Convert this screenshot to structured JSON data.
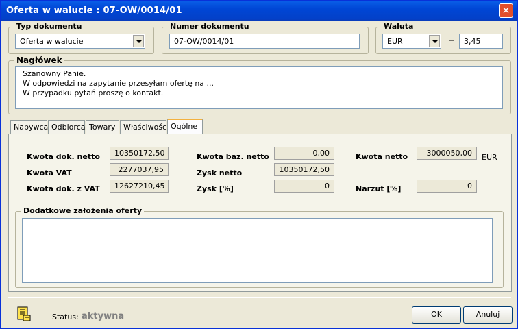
{
  "window": {
    "title": "Oferta w walucie : 07-OW/0014/01",
    "close_glyph": "✕"
  },
  "typ_dokumentu": {
    "legend": "Typ dokumentu",
    "value": "Oferta w walucie"
  },
  "numer_dokumentu": {
    "legend": "Numer dokumentu",
    "value": "07-OW/0014/01"
  },
  "waluta": {
    "legend": "Waluta",
    "value": "EUR",
    "equals": "=",
    "rate": "3,45"
  },
  "naglowek": {
    "legend": "Nagłówek",
    "lines": [
      "Szanowny Panie.",
      "W odpowiedzi na zapytanie przesyłam ofertę na ...",
      "W przypadku pytań proszę o kontakt."
    ]
  },
  "tabs": [
    {
      "label": "Nabywca"
    },
    {
      "label": "Odbiorca"
    },
    {
      "label": "Towary"
    },
    {
      "label": "Właściwości"
    },
    {
      "label": "Ogólne"
    }
  ],
  "summary": {
    "kwota_dok_netto": {
      "label": "Kwota dok. netto",
      "value": "10350172,50"
    },
    "kwota_vat": {
      "label": "Kwota VAT",
      "value": "2277037,95"
    },
    "kwota_dok_z_vat": {
      "label": "Kwota dok. z VAT",
      "value": "12627210,45"
    },
    "kwota_baz_netto": {
      "label": "Kwota baz. netto",
      "value": "0,00"
    },
    "zysk_netto": {
      "label": "Zysk netto",
      "value": "10350172,50"
    },
    "zysk_pct": {
      "label": "Zysk [%]",
      "value": "0"
    },
    "kwota_netto": {
      "label": "Kwota netto",
      "value": "3000050,00",
      "currency": "EUR"
    },
    "narzut_pct": {
      "label": "Narzut [%]",
      "value": "0"
    }
  },
  "dodatkowe": {
    "legend": "Dodatkowe założenia oferty",
    "value": ""
  },
  "status": {
    "label": "Status:",
    "value": "aktywna"
  },
  "buttons": {
    "ok": "OK",
    "cancel": "Anuluj"
  }
}
